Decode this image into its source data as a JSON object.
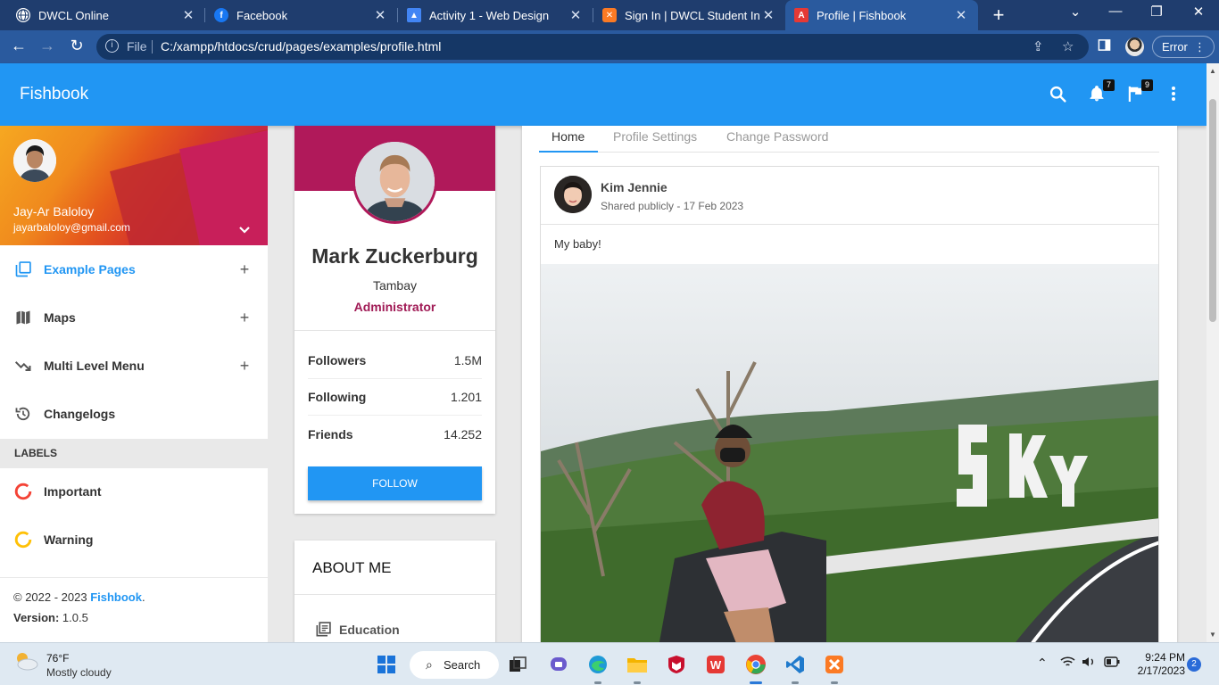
{
  "browser": {
    "tabs": [
      {
        "title": "DWCL Online",
        "icon": "globe-icon"
      },
      {
        "title": "Facebook",
        "icon": "facebook-icon"
      },
      {
        "title": "Activity 1 - Web Design",
        "icon": "classroom-icon"
      },
      {
        "title": "Sign In | DWCL Student Infor",
        "icon": "xampp-icon"
      },
      {
        "title": "Profile | Fishbook",
        "icon": "adminbsb-icon"
      }
    ],
    "address_scheme": "File",
    "url": "C:/xampp/htdocs/crud/pages/examples/profile.html",
    "error_label": "Error"
  },
  "app": {
    "brand": "Fishbook",
    "notifications_count": "7",
    "tasks_count": "9"
  },
  "sidebar": {
    "user_name": "Jay-Ar Baloloy",
    "user_email": "jayarbaloloy@gmail.com",
    "menu": [
      {
        "label": "Example Pages",
        "icon": "pages-icon"
      },
      {
        "label": "Maps",
        "icon": "map-icon"
      },
      {
        "label": "Multi Level Menu",
        "icon": "trending-down-icon"
      },
      {
        "label": "Changelogs",
        "icon": "history-icon"
      }
    ],
    "labels_header": "LABELS",
    "labels": [
      {
        "label": "Important",
        "color": "#f44336"
      },
      {
        "label": "Warning",
        "color": "#ffc107"
      }
    ],
    "copyright": "© 2022 - 2023 ",
    "copyright_brand": "Fishbook",
    "copyright_end": ".",
    "version_label": "Version: ",
    "version": "1.0.5"
  },
  "profile": {
    "name": "Mark Zuckerburg",
    "job": "Tambay",
    "role": "Administrator",
    "stats": [
      {
        "label": "Followers",
        "value": "1.5M"
      },
      {
        "label": "Following",
        "value": "1.201"
      },
      {
        "label": "Friends",
        "value": "14.252"
      }
    ],
    "follow_label": "FOLLOW"
  },
  "about": {
    "title": "ABOUT ME",
    "education_label": "Education"
  },
  "main": {
    "tabs": [
      "Home",
      "Profile Settings",
      "Change Password"
    ],
    "post": {
      "author": "Kim Jennie",
      "meta": "Shared publicly - 17 Feb 2023",
      "text": "My baby!"
    }
  },
  "taskbar": {
    "temperature": "76°F",
    "condition": "Mostly cloudy",
    "search_label": "Search",
    "time": "9:24 PM",
    "date": "2/17/2023",
    "notification_count": "2"
  },
  "colors": {
    "primary": "#2196f3",
    "profile_accent": "#b0195a",
    "browser_tabbar": "#1f3d6e",
    "browser_toolbar": "#2a5a9e"
  }
}
